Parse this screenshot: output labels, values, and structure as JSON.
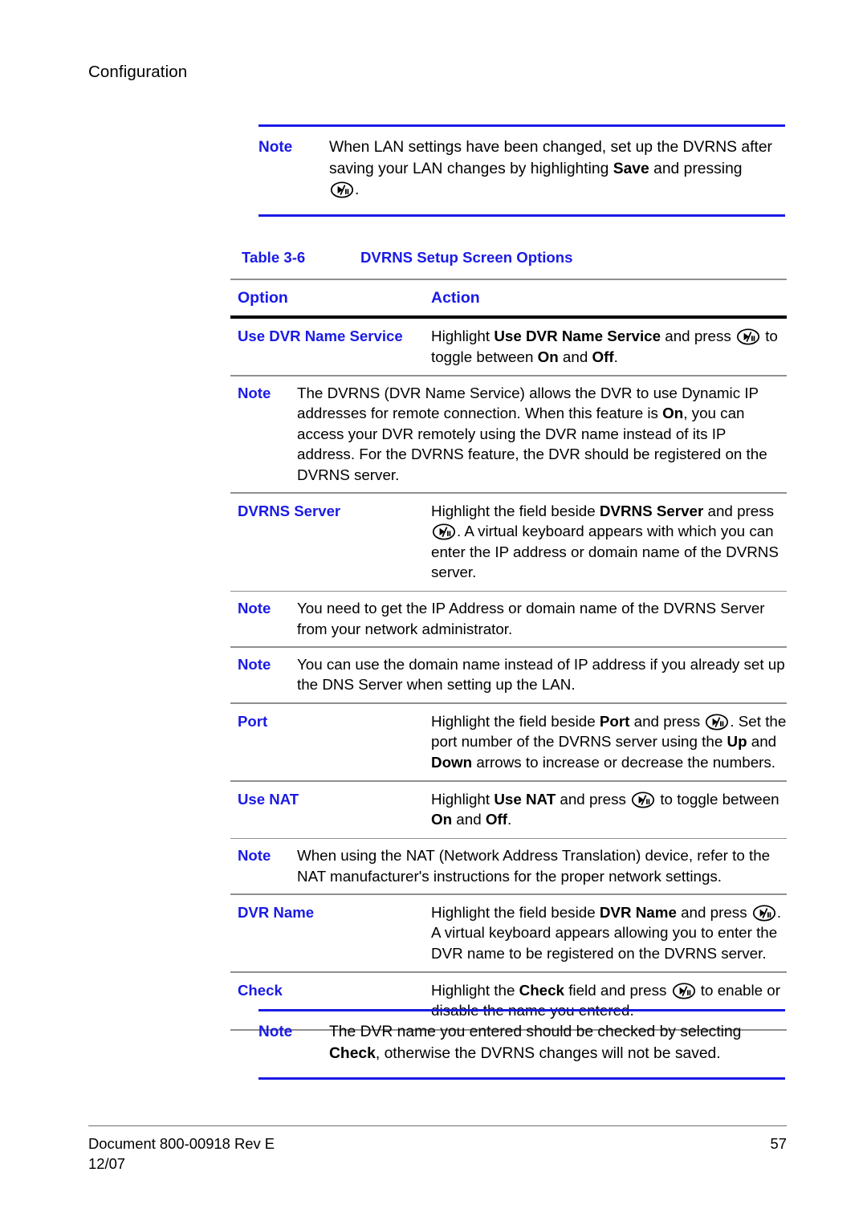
{
  "page": {
    "running_header": "Configuration"
  },
  "icons": {
    "play_pause_key": "play-pause-key-icon"
  },
  "top_note": {
    "label": "Note",
    "text_part1": "When LAN settings have been changed, set up the DVRNS after saving your LAN changes by highlighting ",
    "bold1": "Save",
    "text_part2": " and pressing ",
    "text_part3": "."
  },
  "table": {
    "title_number": "Table 3-6",
    "title_text": "DVRNS Setup Screen Options",
    "header": {
      "option": "Option",
      "action": "Action"
    },
    "rows": [
      {
        "kind": "option",
        "option": "Use DVR Name Service",
        "action_segments": [
          {
            "t": "Highlight "
          },
          {
            "t": "Use DVR Name Service",
            "b": true
          },
          {
            "t": " and press "
          },
          {
            "icon": "play-pause-key-icon"
          },
          {
            "t": " to toggle between "
          },
          {
            "t": "On",
            "b": true
          },
          {
            "t": " and "
          },
          {
            "t": "Off",
            "b": true
          },
          {
            "t": "."
          }
        ]
      },
      {
        "kind": "note",
        "label": "Note",
        "segments": [
          {
            "t": "The DVRNS (DVR Name Service) allows the DVR to use Dynamic IP addresses for remote connection. When this feature is "
          },
          {
            "t": "On",
            "b": true
          },
          {
            "t": ", you can access your DVR remotely using the DVR name instead of its IP address. For the DVRNS feature, the DVR should be registered on the DVRNS server."
          }
        ]
      },
      {
        "kind": "option",
        "option": "DVRNS Server",
        "action_segments": [
          {
            "t": "Highlight the field beside "
          },
          {
            "t": "DVRNS Server",
            "b": true
          },
          {
            "t": " and press "
          },
          {
            "icon": "play-pause-key-icon"
          },
          {
            "t": ". A virtual keyboard appears with which you can enter the IP address or domain name of the DVRNS server."
          }
        ]
      },
      {
        "kind": "note",
        "label": "Note",
        "segments": [
          {
            "t": "You need to get the IP Address or domain name of the DVRNS Server from your network administrator."
          }
        ]
      },
      {
        "kind": "note",
        "label": "Note",
        "segments": [
          {
            "t": "You can use the domain name instead of IP address if you already set up the DNS Server when setting up the LAN."
          }
        ]
      },
      {
        "kind": "option",
        "option": "Port",
        "action_segments": [
          {
            "t": "Highlight the field beside "
          },
          {
            "t": "Port",
            "b": true
          },
          {
            "t": " and press "
          },
          {
            "icon": "play-pause-key-icon"
          },
          {
            "t": ". Set the port number of the DVRNS server using the "
          },
          {
            "t": "Up",
            "b": true
          },
          {
            "t": " and "
          },
          {
            "t": "Down",
            "b": true
          },
          {
            "t": " arrows to increase or decrease the numbers."
          }
        ]
      },
      {
        "kind": "option",
        "option": "Use NAT",
        "action_segments": [
          {
            "t": "Highlight "
          },
          {
            "t": "Use NAT",
            "b": true
          },
          {
            "t": " and press "
          },
          {
            "icon": "play-pause-key-icon"
          },
          {
            "t": " to toggle between "
          },
          {
            "t": "On",
            "b": true
          },
          {
            "t": " and "
          },
          {
            "t": "Off",
            "b": true
          },
          {
            "t": "."
          }
        ]
      },
      {
        "kind": "note",
        "label": "Note",
        "segments": [
          {
            "t": "When using the NAT (Network Address Translation) device, refer to the NAT manufacturer's instructions for the proper network settings."
          }
        ]
      },
      {
        "kind": "option",
        "option": "DVR Name",
        "action_segments": [
          {
            "t": "Highlight the field beside "
          },
          {
            "t": "DVR Name",
            "b": true
          },
          {
            "t": " and press "
          },
          {
            "icon": "play-pause-key-icon"
          },
          {
            "t": ". A virtual keyboard appears allowing you to enter the DVR name to be registered on the DVRNS server."
          }
        ]
      },
      {
        "kind": "option",
        "option": "Check",
        "action_segments": [
          {
            "t": "Highlight the "
          },
          {
            "t": "Check",
            "b": true
          },
          {
            "t": " field and press "
          },
          {
            "icon": "play-pause-key-icon"
          },
          {
            "t": " to enable or disable the name you entered."
          }
        ]
      }
    ]
  },
  "bottom_note": {
    "label": "Note",
    "segments": [
      {
        "t": "The DVR name you entered should be checked by selecting "
      },
      {
        "t": "Check",
        "b": true
      },
      {
        "t": ", otherwise the DVRNS changes will not be saved."
      }
    ]
  },
  "footer": {
    "document": "Document 800-00918 Rev E",
    "date": "12/07",
    "page_number": "57"
  },
  "colors": {
    "accent_blue": "#1a1ae6",
    "rule_gray": "#8f8f8f",
    "rule_black": "#000000"
  }
}
